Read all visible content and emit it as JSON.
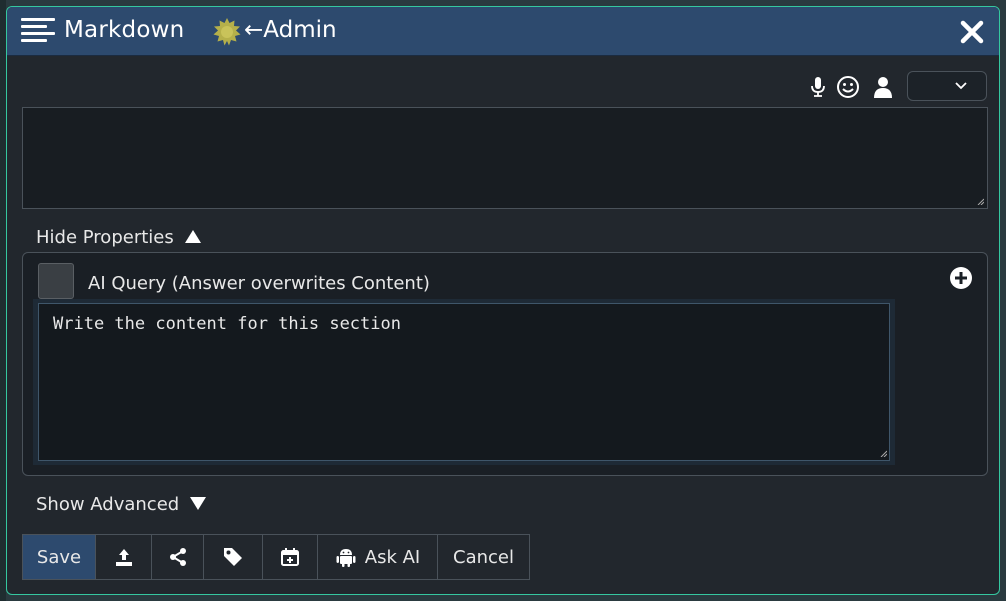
{
  "titlebar": {
    "title": "Markdown",
    "admin_label": "←Admin",
    "icons": [
      "menu-icon",
      "badge-icon",
      "close-icon"
    ]
  },
  "editor": {
    "toolbar_icons": [
      "microphone-icon",
      "smiley-icon",
      "user-icon",
      "chevron-down-icon"
    ],
    "content_value": "",
    "select_value": ""
  },
  "properties": {
    "toggle_label": "Hide Properties",
    "ai_query_label": "AI Query (Answer overwrites Content)",
    "ai_query_checked": false,
    "query_value": "Write the content for this section"
  },
  "advanced": {
    "toggle_label": "Show Advanced"
  },
  "buttons": {
    "save": "Save",
    "ask_ai": "Ask AI",
    "cancel": "Cancel",
    "icons": [
      "upload-icon",
      "share-icon",
      "tag-icon",
      "calendar-add-icon",
      "android-icon"
    ]
  },
  "colors": {
    "titlebar": "#2d4a6e",
    "dialog_border": "#35c8a0",
    "badge": "#b5b04a",
    "background": "#22272d"
  }
}
